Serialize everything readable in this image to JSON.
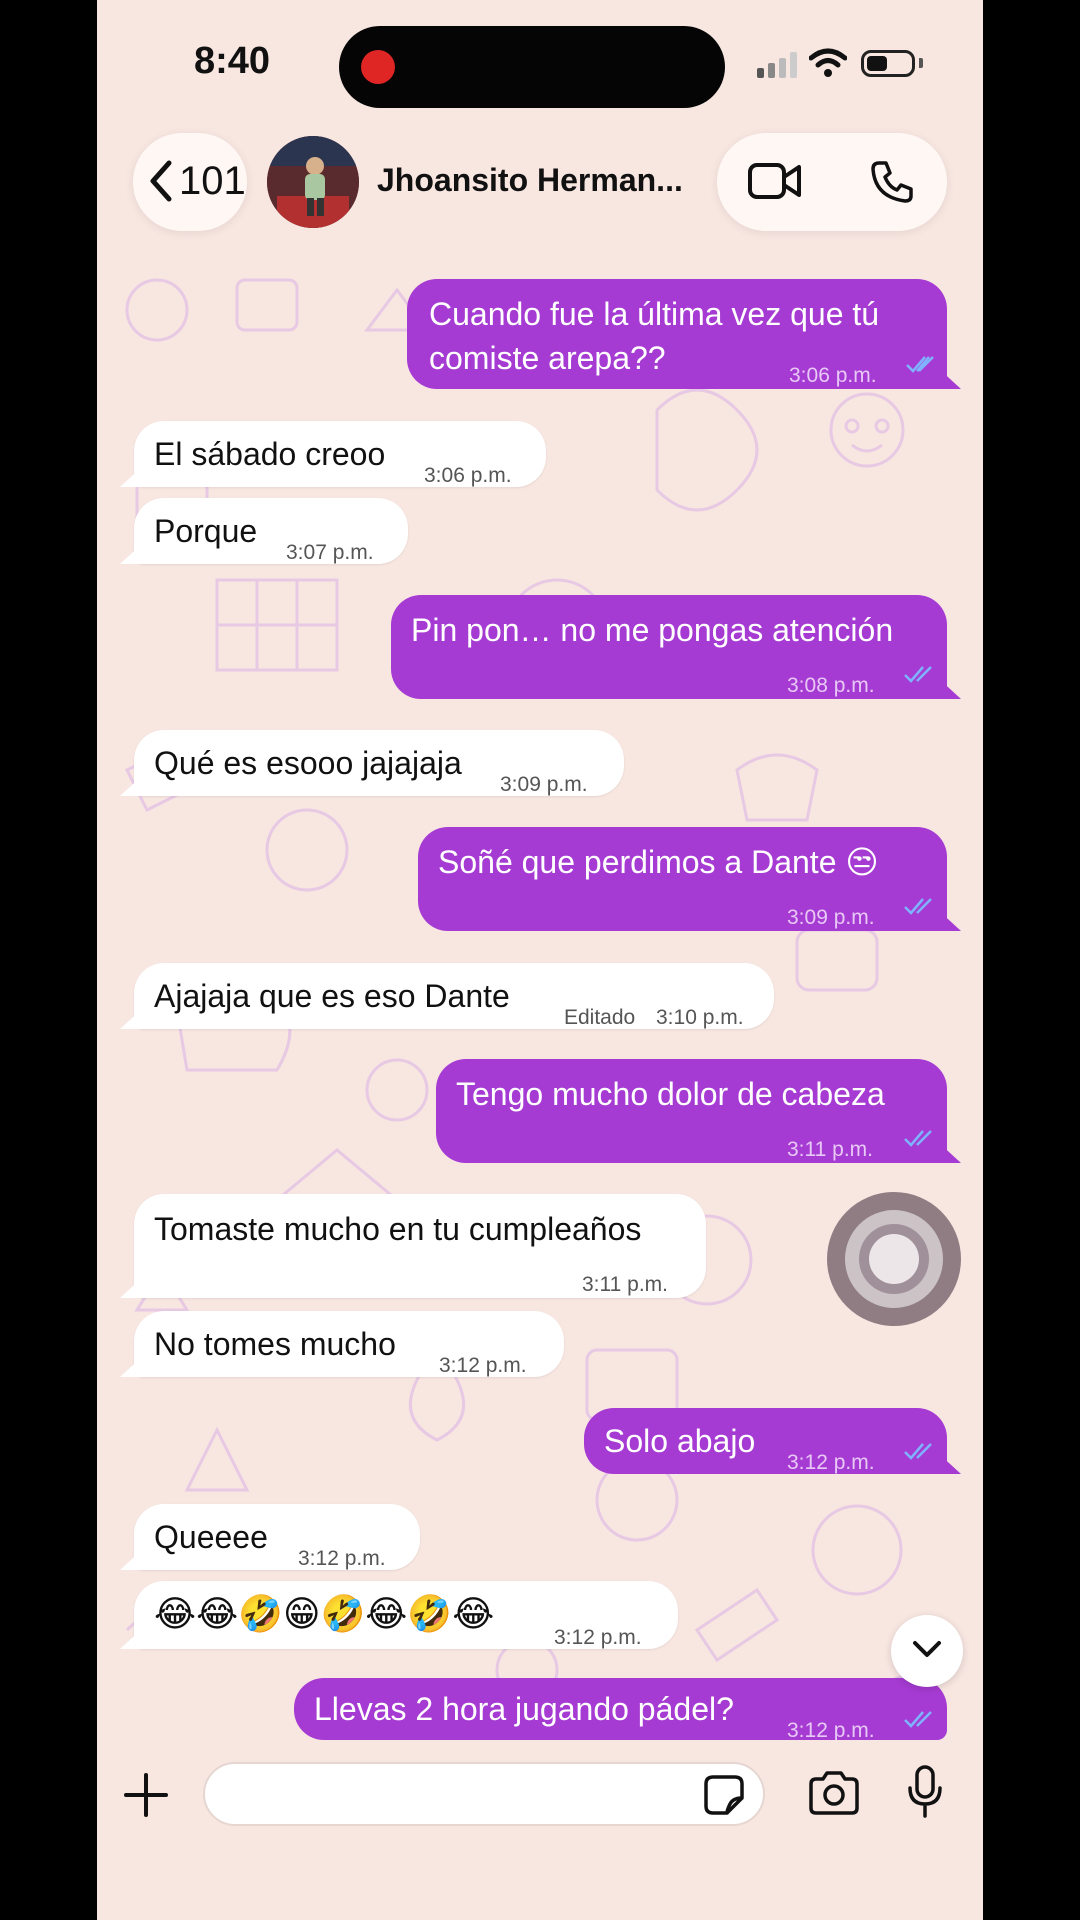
{
  "status": {
    "time": "8:40"
  },
  "header": {
    "back_count": "101",
    "contact_name": "Jhoansito Herman...",
    "icons": [
      "chevron-left-icon",
      "video-call-icon",
      "phone-icon"
    ]
  },
  "messages": [
    {
      "dir": "out",
      "lines": [
        "Cuando fue la última vez que tú",
        "comiste arepa??"
      ],
      "time": "3:06 p.m.",
      "ticks": "read"
    },
    {
      "dir": "in",
      "text": "El sábado creoo",
      "time": "3:06 p.m."
    },
    {
      "dir": "in",
      "text": "Porque",
      "time": "3:07 p.m."
    },
    {
      "dir": "out",
      "text": "Pin pon… no me pongas atención",
      "time": "3:08 p.m.",
      "ticks": "read"
    },
    {
      "dir": "in",
      "text": "Qué es esooo jajajaja",
      "time": "3:09 p.m."
    },
    {
      "dir": "out",
      "text": "Soñé que perdimos a Dante 😒",
      "time": "3:09 p.m.",
      "ticks": "read"
    },
    {
      "dir": "in",
      "text": "Ajajaja que es eso Dante",
      "edited": "Editado",
      "time": "3:10 p.m."
    },
    {
      "dir": "out",
      "text": "Tengo mucho dolor de cabeza",
      "time": "3:11 p.m.",
      "ticks": "read"
    },
    {
      "dir": "in",
      "text": "Tomaste mucho en tu cumpleaños",
      "time": "3:11 p.m."
    },
    {
      "dir": "in",
      "text": "No tomes mucho",
      "time": "3:12 p.m."
    },
    {
      "dir": "out",
      "text": "Solo abajo",
      "time": "3:12 p.m.",
      "ticks": "read"
    },
    {
      "dir": "in",
      "text": "Queeee",
      "time": "3:12 p.m."
    },
    {
      "dir": "in",
      "text": "😂😂🤣😁🤣😂🤣😂",
      "time": "3:12 p.m."
    },
    {
      "dir": "out",
      "text": "Llevas 2 hora jugando pádel?",
      "time": "3:12 p.m.",
      "ticks": "read"
    }
  ],
  "composer": {
    "placeholder": "",
    "value": ""
  },
  "colors": {
    "outgoing_bubble": "#a63bd3",
    "incoming_bubble": "#ffffff",
    "background": "#f8e6e1",
    "read_ticks": "#7fb3ff"
  }
}
